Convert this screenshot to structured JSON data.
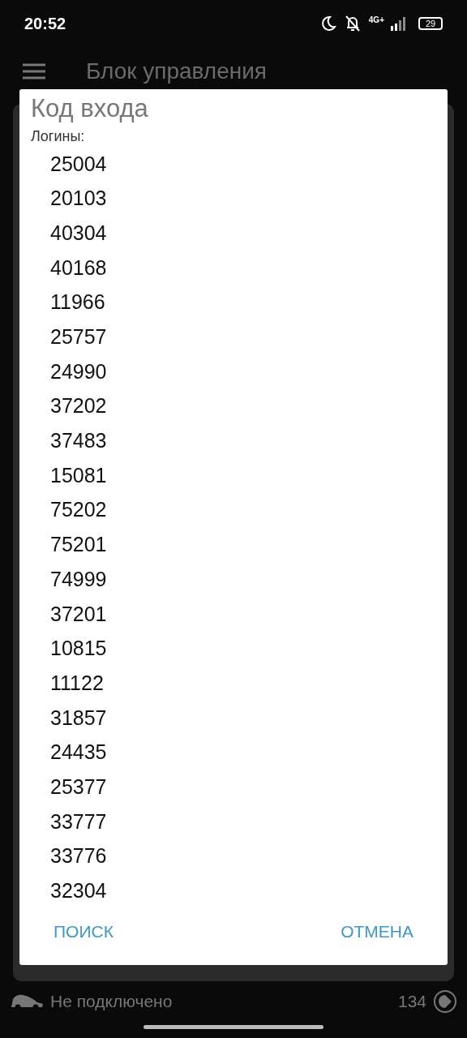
{
  "status_bar": {
    "time": "20:52",
    "network": "4G+",
    "battery": "29"
  },
  "app_bar": {
    "title": "Блок управления"
  },
  "dialog": {
    "title": "Код входа",
    "label": "Логины:",
    "logins": [
      "25004",
      "20103",
      "40304",
      "40168",
      "11966",
      "25757",
      "24990",
      "37202",
      "37483",
      "15081",
      "75202",
      "75201",
      "74999",
      "37201",
      "10815",
      "11122",
      "31857",
      "24435",
      "25377",
      "33777",
      "33776",
      "32304"
    ],
    "buttons": [
      "ПОИСК",
      "ОТМЕНА"
    ]
  },
  "footer": {
    "connection": "Не подключено",
    "count": "134"
  }
}
